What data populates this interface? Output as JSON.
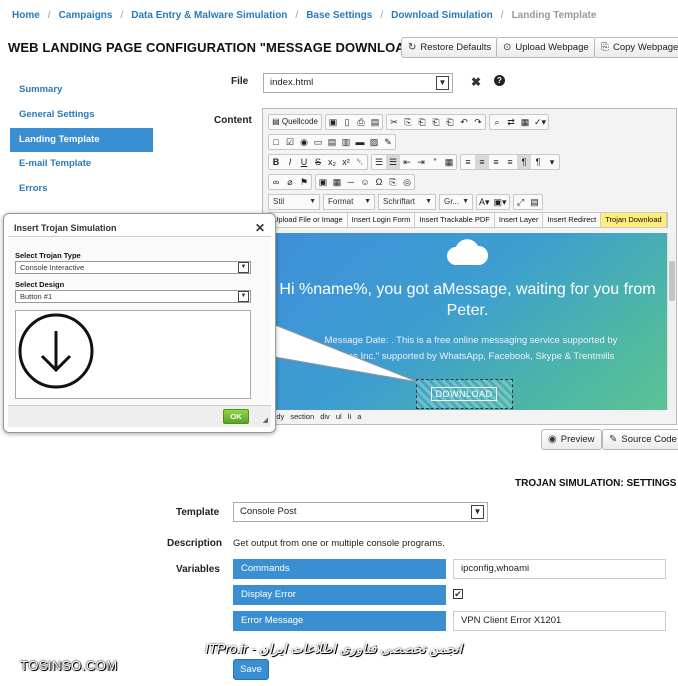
{
  "breadcrumb": [
    "Home",
    "Campaigns",
    "Data Entry & Malware Simulation",
    "Base Settings",
    "Download Simulation",
    "Landing Template"
  ],
  "page_title": "WEB LANDING PAGE CONFIGURATION \"MESSAGE DOWNLOAD\"",
  "header_buttons": {
    "restore": "Restore Defaults",
    "upload": "Upload Webpage",
    "copy": "Copy Webpage"
  },
  "nav": [
    "Summary",
    "General Settings",
    "Landing Template",
    "E-mail Template",
    "Errors"
  ],
  "file": {
    "label": "File",
    "value": "index.html"
  },
  "content_label": "Content",
  "editor": {
    "source_label": "Quellcode",
    "combos": [
      "Stil",
      "Format",
      "Schriftart",
      "Gr..."
    ],
    "plugins": [
      "Upload File or Image",
      "Insert Login Form",
      "Insert Trackable PDF",
      "Insert Layer",
      "Insert Redirect",
      "Trojan Download"
    ],
    "preview_title": "Hi %name%, you got aMessage, waiting for you from Peter.",
    "preview_text_1": "Message Date: . This is a free online messaging service supported by",
    "preview_text_2": "…ages Inc.\" supported by WhatsApp, Facebook, Skype & Trentmills",
    "download_label": "DOWNLOAD",
    "status_path": "body section div ul li a"
  },
  "editor_buttons": {
    "preview": "Preview",
    "source": "Source Code"
  },
  "dialog": {
    "title": "Insert Trojan Simulation",
    "type_label": "Select Trojan Type",
    "type_value": "Console Interactive",
    "design_label": "Select Design",
    "design_value": "Button #1",
    "ok": "OK"
  },
  "settings": {
    "title": "TROJAN SIMULATION: SETTINGS",
    "template_label": "Template",
    "template_value": "Console Post",
    "description_label": "Description",
    "description_value": "Get output from one or multiple console programs.",
    "variables_label": "Variables",
    "vars": [
      {
        "name": "Commands",
        "value": "ipconfig,whoami"
      },
      {
        "name": "Display Error",
        "value": ""
      },
      {
        "name": "Error Message",
        "value": "VPN Client Error X1201"
      }
    ],
    "save": "Save"
  },
  "watermarks": {
    "left": "TOSINSO.COM",
    "center": "ITPro.ir - انجمن تخصصی فناوری اطلاعات ایران"
  },
  "colors": {
    "accent": "#3a8fd3",
    "link": "#2a7ab9",
    "trojan_highlight": "#ffed7a",
    "ok_green": "#6cbf35"
  }
}
